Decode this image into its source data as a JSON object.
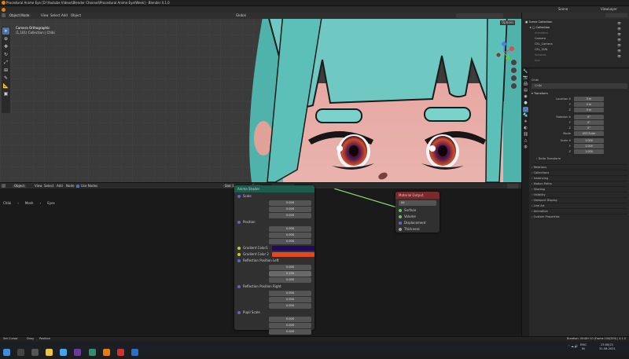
{
  "window": {
    "title": "Procedural Anime Eye [D:\\Youtube Videos\\Blender Channel\\Procedural Anime Eye\\Week] - Blender 4.1.0",
    "buttons": [
      "–",
      "▢",
      "✕"
    ]
  },
  "menu": {
    "items": [
      "File",
      "Edit",
      "Render",
      "Window",
      "Help"
    ]
  },
  "workspaces": {
    "tabs": [
      "Layout",
      "Modeling",
      "Sculpting",
      "UV Editing",
      "Texture Paint",
      "Shading",
      "Animation",
      "Rendering",
      "Compositing",
      "Geometry Nodes",
      "Scripting"
    ],
    "active": "Shading"
  },
  "scene": {
    "label": "Scene",
    "viewlayer": "ViewLayer"
  },
  "viewport": {
    "mode": "Object Mode",
    "menus": [
      "View",
      "Select",
      "Add",
      "Object"
    ],
    "shading": "Global",
    "info_title": "Camera Orthographic",
    "info_sub": "(1,101) Collection | Chibi",
    "options": "Options"
  },
  "node_editor": {
    "header_menus": [
      "Object",
      "View",
      "Select",
      "Add",
      "Node"
    ],
    "use_nodes": "Use Nodes",
    "slot": "Slot 1",
    "material": "Eyes",
    "breadcrumb": [
      "Chibi",
      "Mesh",
      "Eyes"
    ],
    "group_node": {
      "title": "Anime Shader",
      "sections": [
        {
          "label": "Scale",
          "socket_color": "#6363c7",
          "values": [
            "0.000",
            "0.000",
            "0.000"
          ]
        },
        {
          "label": "Position",
          "socket_color": "#6363c7",
          "values": [
            "0.000",
            "0.000",
            "0.000"
          ]
        }
      ],
      "colors": [
        {
          "label": "Gradient Color1",
          "swatch": "#24095a"
        },
        {
          "label": "Gradient Color 2",
          "swatch": "#e14a1d"
        }
      ],
      "sections2": [
        {
          "label": "Reflection Position Left",
          "socket_color": "#6363c7",
          "values": [
            "0.000",
            "0.100",
            "0.000"
          ]
        },
        {
          "label": "Reflection Position Right",
          "socket_color": "#6363c7",
          "values": [
            "0.000",
            "0.000",
            "0.000"
          ]
        },
        {
          "label": "Pupil Scale",
          "socket_color": "#6363c7",
          "values": [
            "0.000",
            "0.000",
            "0.000"
          ]
        }
      ]
    },
    "output_node": {
      "title": "Material Output",
      "target": "All",
      "sockets": [
        {
          "label": "Surface",
          "color": "#63c763"
        },
        {
          "label": "Volume",
          "color": "#63c763"
        },
        {
          "label": "Displacement",
          "color": "#6363c7"
        },
        {
          "label": "Thickness",
          "color": "#a1a1a1"
        }
      ]
    }
  },
  "outliner": {
    "title": "Scene Collection",
    "items": [
      {
        "label": "Collection",
        "indent": 1,
        "dim": false
      },
      {
        "label": "Armature",
        "indent": 2,
        "dim": true
      },
      {
        "label": "Camera",
        "indent": 2,
        "dim": false
      },
      {
        "label": "CEL_Camera",
        "indent": 2,
        "dim": false
      },
      {
        "label": "CEL_SUN",
        "indent": 2,
        "dim": false
      },
      {
        "label": "Spheres",
        "indent": 2,
        "dim": true
      },
      {
        "label": "Sun",
        "indent": 2,
        "dim": true
      }
    ]
  },
  "properties": {
    "object_name": "Chibi",
    "object_field": "Chibi",
    "transform": {
      "header": "Transform",
      "location": {
        "label": "Location X",
        "values": [
          "0 m",
          "0 m",
          "0 m"
        ]
      },
      "rotation": {
        "label": "Rotation X",
        "values": [
          "0°",
          "0°",
          "0°"
        ]
      },
      "mode_label": "Mode",
      "mode": "XYZ Euler",
      "scale": {
        "label": "Scale X",
        "values": [
          "1.000",
          "1.000",
          "1.000"
        ]
      },
      "delta": "Delta Transform"
    },
    "panels": [
      "Relations",
      "Collections",
      "Instancing",
      "Motion Paths",
      "Shading",
      "Visibility",
      "Viewport Display",
      "Line Art",
      "Animation",
      "Custom Properties"
    ]
  },
  "statusbar": {
    "items": [
      "Set Cursor",
      "Drag",
      "Position"
    ],
    "right": "Duration: 00:08+10 (Frame 104/250) | 4.1.0"
  },
  "taskbar": {
    "lang": "ENG",
    "region": "IN",
    "time": "23:08/21",
    "date": "31-08-2021"
  }
}
